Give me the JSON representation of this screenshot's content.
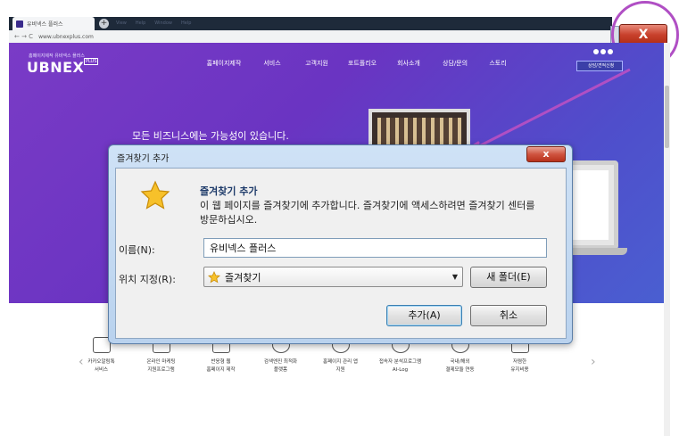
{
  "browser": {
    "tab_title": "유비넥스 플러스",
    "menu_items": [
      "View",
      "Help",
      "Window",
      "Help"
    ],
    "nav": "← → C",
    "url": "www.ubnexplus.com",
    "close_glyph": "X"
  },
  "site": {
    "logo_small": "홈페이지제작 유비넥스 플러스",
    "logo": "UBNEX",
    "logo_plus": "PLUS",
    "gnb": [
      "홈페이지제작",
      "서비스",
      "고객지원",
      "포트폴리오",
      "회사소개",
      "상담/문의",
      "스토리"
    ],
    "consult_label": "상담/견적신청",
    "hero_title": "모든 비즈니스에는 가능성이 있습니다.",
    "services": [
      {
        "l1": "카카오알림톡",
        "l2": "서비스",
        "icon": "phone-icon"
      },
      {
        "l1": "온라인 마케팅",
        "l2": "지원프로그램",
        "icon": "board-icon"
      },
      {
        "l1": "반응형 웹",
        "l2": "홈페이지 제작",
        "icon": "monitor-icon"
      },
      {
        "l1": "검색엔진 최적화",
        "l2": "플랫폼",
        "icon": "globe-icon"
      },
      {
        "l1": "홈페이지 관리 앱",
        "l2": "지원",
        "icon": "cloud-icon"
      },
      {
        "l1": "접속자 분석프로그램",
        "l2": "AI-Log",
        "icon": "chart-icon"
      },
      {
        "l1": "국내/해외",
        "l2": "결제모듈 연동",
        "icon": "globe-card-icon"
      },
      {
        "l1": "저렴한",
        "l2": "유지비용",
        "icon": "grid-icon"
      }
    ]
  },
  "dialog": {
    "title": "즐겨찾기 추가",
    "close_glyph": "x",
    "heading": "즐겨찾기 추가",
    "description": "이 웹 페이지를 즐겨찾기에 추가합니다. 즐겨찾기에 액세스하려면 즐겨찾기 센터를 방문하십시오.",
    "name_label": "이름(N):",
    "name_value": "유비넥스 플러스",
    "location_label": "위치 지정(R):",
    "location_value": "즐겨찾기",
    "new_folder_label": "새 폴더(E)",
    "add_label": "추가(A)",
    "cancel_label": "취소"
  },
  "colors": {
    "hero_start": "#7a3bc6",
    "hero_end": "#4a5fd1",
    "callout": "#b04fc4",
    "close_red": "#c8412c"
  }
}
